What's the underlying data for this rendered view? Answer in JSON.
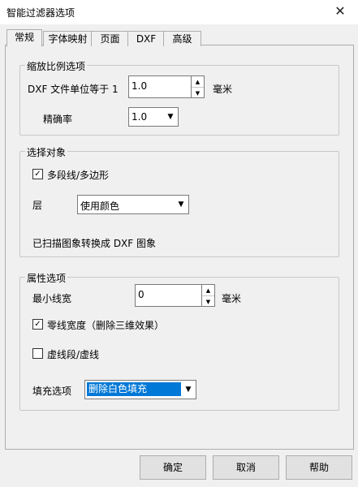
{
  "window": {
    "title": "智能过滤器选项",
    "close_glyph": "✕"
  },
  "tabs": [
    {
      "label": "常规",
      "active": true
    },
    {
      "label": "字体映射",
      "active": false
    },
    {
      "label": "页面",
      "active": false
    },
    {
      "label": "DXF",
      "active": false
    },
    {
      "label": "高级",
      "active": false
    }
  ],
  "scale_group": {
    "legend": "缩放比例选项",
    "dxf_unit_label": "DXF 文件单位等于 1",
    "dxf_unit_value": "1.0",
    "dxf_unit_suffix": "毫米",
    "precision_label": "精确率",
    "precision_value": "1.0"
  },
  "select_group": {
    "legend": "选择对象",
    "polyline_checkbox_label": "多段线/多边形",
    "polyline_checked": true,
    "layer_label": "层",
    "layer_value": "使用颜色",
    "info_text": "已扫描图象转换成 DXF 图象"
  },
  "attr_group": {
    "legend": "属性选项",
    "min_width_label": "最小线宽",
    "min_width_value": "0",
    "min_width_suffix": "毫米",
    "zero_width_label": "零线宽度（删除三维效果）",
    "zero_width_checked": true,
    "dashed_label": "虚线段/虚线",
    "dashed_checked": false,
    "fill_label": "填充选项",
    "fill_value": "删除白色填充"
  },
  "buttons": {
    "ok": "确定",
    "cancel": "取消",
    "help": "帮助"
  },
  "icons": {
    "spin_up": "▲",
    "spin_down": "▼",
    "dropdown": "▼",
    "check": "✓"
  },
  "colors": {
    "accent": "#0078d7",
    "window_bg": "#f0f0f0"
  }
}
